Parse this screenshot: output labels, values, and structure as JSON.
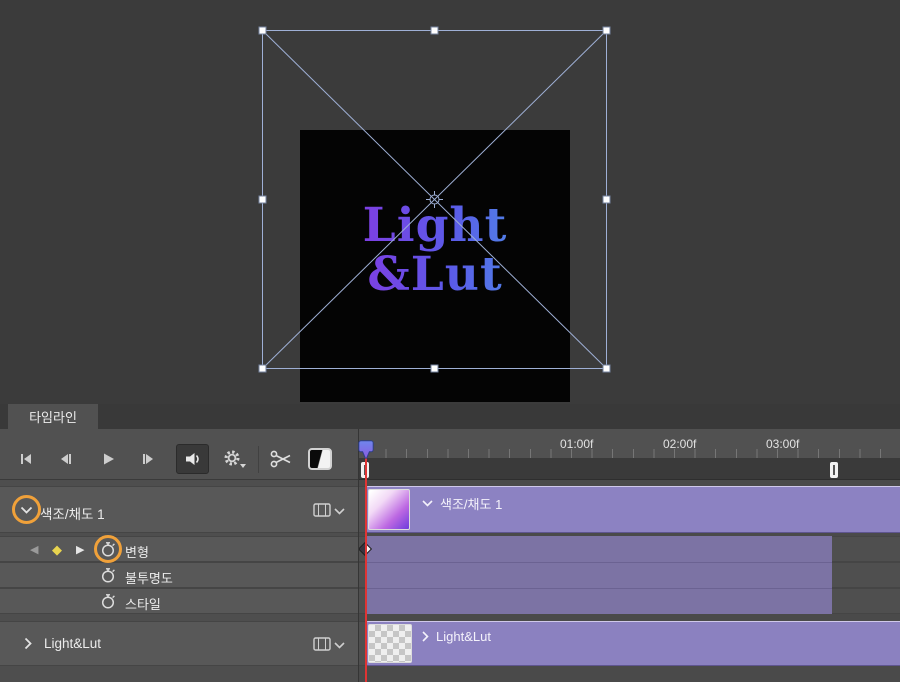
{
  "canvas": {
    "logo_line1": "Light",
    "logo_line2": "&Lut"
  },
  "timeline": {
    "tab_label": "타임라인",
    "ruler_labels": [
      "01:00f",
      "02:00f",
      "03:00f"
    ],
    "tracks": {
      "hue_sat": {
        "label": "색조/채도 1"
      },
      "transform": {
        "label": "변형"
      },
      "opacity": {
        "label": "불투명도"
      },
      "style": {
        "label": "스타일"
      },
      "light_lut": {
        "label": "Light&Lut"
      }
    },
    "icons": {
      "keyframe_prev": "◀",
      "keyframe_current": "◆",
      "keyframe_next": "▶"
    }
  },
  "colors": {
    "clip_purple": "#8c82c2",
    "band_purple": "#7c73a4",
    "playhead_red": "#df3434",
    "annotation_orange": "#f0a13a",
    "keyframe_yellow": "#e8d44f",
    "logo_gradient_start": "#9030e0",
    "logo_gradient_end": "#46a2e6"
  }
}
